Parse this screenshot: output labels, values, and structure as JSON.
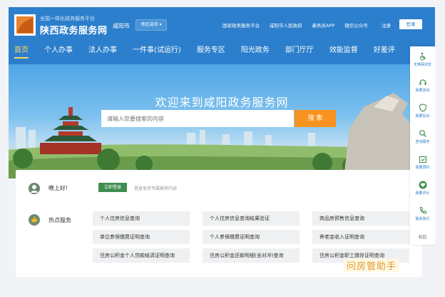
{
  "header": {
    "site_subtitle": "全国一体化政务服务平台",
    "site_name": "陕西政务服务网",
    "city": "咸阳市",
    "city_select": "地区选择",
    "top_links": [
      "国家政务服务平台",
      "咸阳市人民政府",
      "秦务员APP",
      "微信公众号"
    ],
    "register": "注册",
    "login": "登录"
  },
  "nav": {
    "items": [
      "首页",
      "个人办事",
      "法人办事",
      "一件事(试运行)",
      "服务专区",
      "阳光政务",
      "部门厅厅",
      "效能监督",
      "好差评"
    ],
    "active_index": 0
  },
  "hero": {
    "title": "欢迎来到咸阳政务服务网",
    "search_placeholder": "请输入您要搜索的内容",
    "search_button": "搜 索"
  },
  "greeting": {
    "text": "晚上好!",
    "login_button": "立即登录",
    "login_tip": "登录享受专属推荐内容"
  },
  "hot_services": {
    "label": "热点服务",
    "items": [
      "个人住房信息查询",
      "个人住房信息查询结果验证",
      "商品房预售信息查询",
      "单位参保缴费证明查询",
      "个人参保缴费证明查询",
      "养老金收入证明查询",
      "住房公积金个人贷款结清证明查询",
      "住房公积金还款明细(含对冲)查询",
      "住房公积金职工缴存证明查询"
    ]
  },
  "sidebar": {
    "items": [
      "无障碍浏览",
      "我要咨询",
      "我要投诉",
      "查询服务",
      "我要预约",
      "我要评价",
      "联系我们"
    ],
    "collapse": "收起"
  },
  "watermark": "问房管助手",
  "colors": {
    "header": "#2c7fcc",
    "accent": "#f7931e",
    "green": "#3e8e4f"
  }
}
